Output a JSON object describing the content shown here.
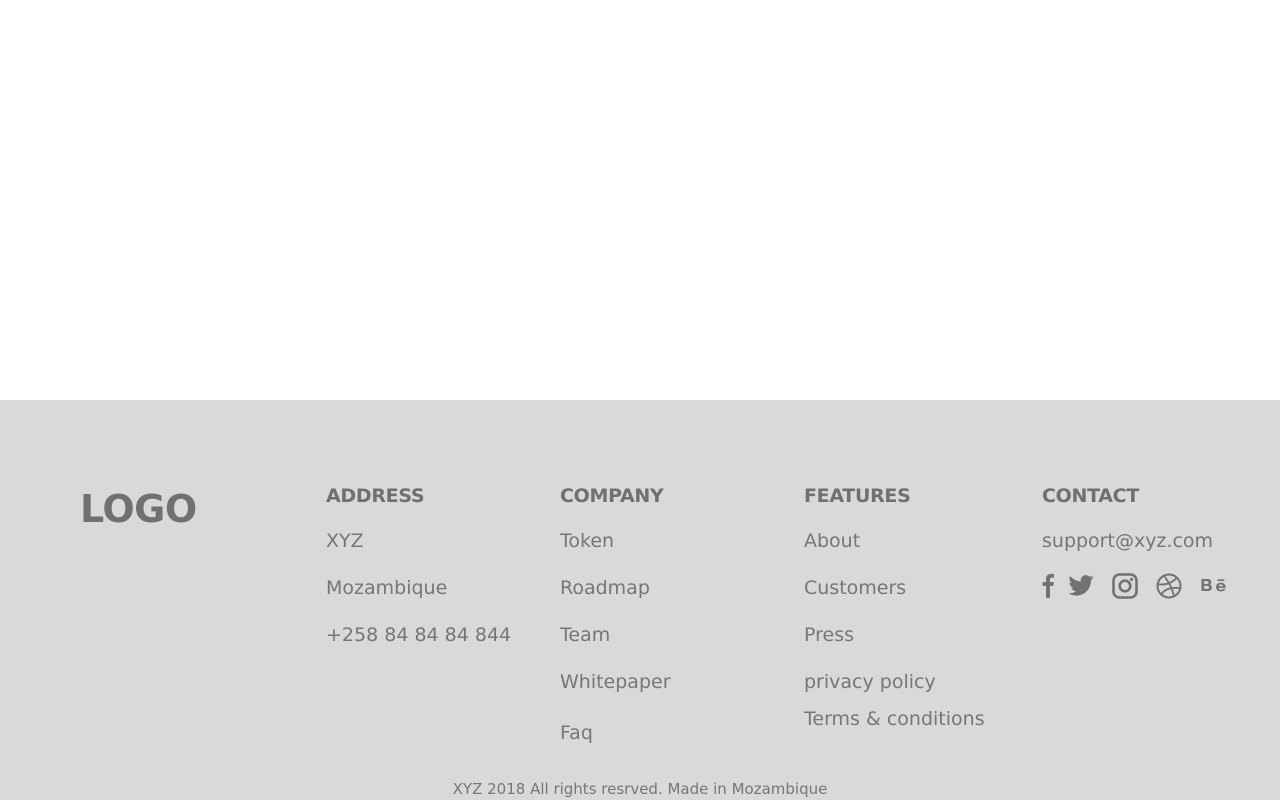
{
  "footer": {
    "logo": "LOGO",
    "address": {
      "heading": "ADDRESS",
      "lines": [
        "XYZ",
        "Mozambique",
        "+258 84 84 84 844"
      ]
    },
    "company": {
      "heading": "COMPANY",
      "links": [
        "Token",
        "Roadmap",
        "Team",
        "Whitepaper",
        "Faq"
      ]
    },
    "features": {
      "heading": "FEATURES",
      "links": [
        "About",
        "Customers",
        "Press",
        "privacy policy",
        "Terms & conditions"
      ]
    },
    "contact": {
      "heading": "CONTACT",
      "email": "support@xyz.com",
      "socials": [
        "facebook-icon",
        "twitter-icon",
        "instagram-icon",
        "dribbble-icon",
        "behance-icon"
      ]
    },
    "copyright": "XYZ 2018 All rights resrved. Made in Mozambique"
  },
  "colors": {
    "footer_background": "#d9d9d9",
    "page_background": "#ffffff",
    "text": "#747474"
  }
}
